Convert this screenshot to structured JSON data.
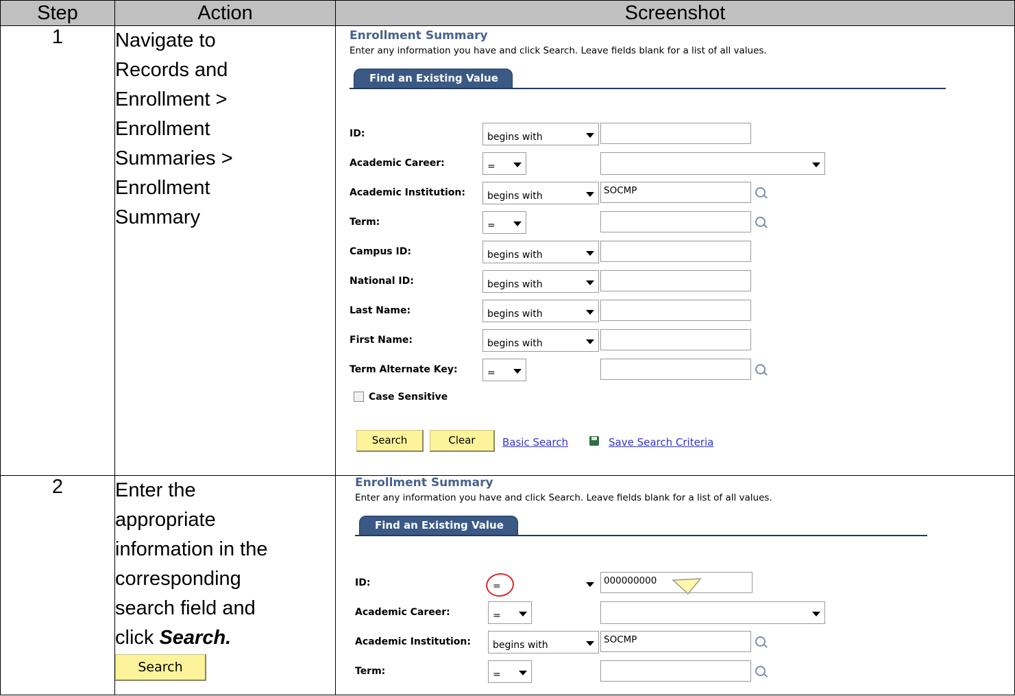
{
  "headers": {
    "step": "Step",
    "action": "Action",
    "screenshot": "Screenshot"
  },
  "step1": {
    "number": "1",
    "action_lines": [
      "Navigate to",
      "Records and",
      "Enrollment >",
      "Enrollment",
      "Summaries >",
      "Enrollment",
      "Summary"
    ],
    "page_title": "Enrollment Summary",
    "instructions": "Enter any information you have and click Search. Leave fields blank for a list of all values.",
    "tab": "Find an Existing Value",
    "fields": [
      {
        "label": "ID:",
        "operator": "begins with",
        "value": "",
        "lookup": false
      },
      {
        "label": "Academic Career:",
        "operator": "=",
        "value": "",
        "lookup": false,
        "dropdown": true
      },
      {
        "label": "Academic Institution:",
        "operator": "begins with",
        "value": "SOCMP",
        "lookup": true
      },
      {
        "label": "Term:",
        "operator": "=",
        "value": "",
        "lookup": true
      },
      {
        "label": "Campus ID:",
        "operator": "begins with",
        "value": "",
        "lookup": false
      },
      {
        "label": "National ID:",
        "operator": "begins with",
        "value": "",
        "lookup": false
      },
      {
        "label": "Last Name:",
        "operator": "begins with",
        "value": "",
        "lookup": false
      },
      {
        "label": "First Name:",
        "operator": "begins with",
        "value": "",
        "lookup": false
      },
      {
        "label": "Term Alternate Key:",
        "operator": "=",
        "value": "",
        "lookup": true
      }
    ],
    "case_sensitive": "Case Sensitive",
    "search_btn": "Search",
    "clear_btn": "Clear",
    "basic_search": "Basic Search",
    "save_criteria": "Save Search Criteria"
  },
  "step2": {
    "number": "2",
    "action_lines": [
      "Enter the",
      "appropriate",
      "information in the",
      "corresponding",
      "search field and"
    ],
    "action_click": "click ",
    "action_bold": "Search.",
    "search_btn": "Search",
    "page_title": "Enrollment Summary",
    "instructions": "Enter any information you have and click Search. Leave fields blank for a list of all values.",
    "tab": "Find an Existing Value",
    "fields": [
      {
        "label": "ID:",
        "operator": "=",
        "value": "000000000"
      },
      {
        "label": "Academic Career:",
        "operator": "=",
        "value": ""
      },
      {
        "label": "Academic Institution:",
        "operator": "begins with",
        "value": "SOCMP"
      },
      {
        "label": "Term:",
        "operator": "=",
        "value": ""
      }
    ]
  }
}
